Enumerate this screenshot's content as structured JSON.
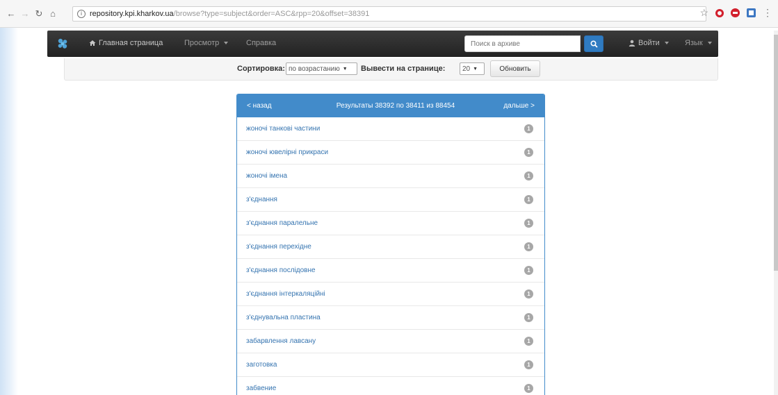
{
  "browser": {
    "url_host": "repository.kpi.kharkov.ua",
    "url_path": "/browse?type=subject&order=ASC&rpp=20&offset=38391"
  },
  "navbar": {
    "home": "Главная страница",
    "browse": "Просмотр",
    "help": "Справка",
    "search_placeholder": "Поиск в архиве",
    "login": "Войти",
    "language": "Язык"
  },
  "sortbar": {
    "sort_label": "Сортировка:",
    "sort_value": "по возрастанию",
    "per_page_label": "Вывести на странице:",
    "per_page_value": "20",
    "update_button": "Обновить"
  },
  "results": {
    "prev": "< назад",
    "info": "Результаты 38392 по 38411 из 88454",
    "next": "дальше >",
    "items": [
      {
        "term": "жоночі танкові частини",
        "count": "1"
      },
      {
        "term": "жоночі ювелірні прикраси",
        "count": "1"
      },
      {
        "term": "жоночі імена",
        "count": "1"
      },
      {
        "term": "з'єднання",
        "count": "1"
      },
      {
        "term": "з'єднання паралельне",
        "count": "1"
      },
      {
        "term": "з'єднання перехідне",
        "count": "1"
      },
      {
        "term": "з'єднання послідовне",
        "count": "1"
      },
      {
        "term": "з'єднання інтеркаляційні",
        "count": "1"
      },
      {
        "term": "з'єднувальна пластина",
        "count": "1"
      },
      {
        "term": "забарвлення лавсану",
        "count": "1"
      },
      {
        "term": "заготовка",
        "count": "1"
      },
      {
        "term": "забвение",
        "count": "1"
      }
    ]
  }
}
